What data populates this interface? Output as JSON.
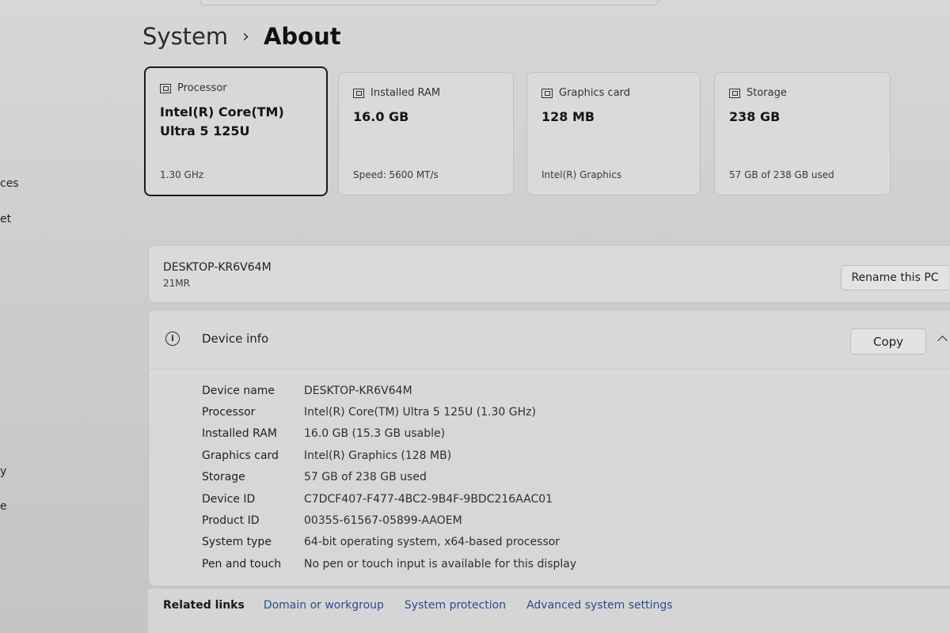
{
  "breadcrumb": {
    "parent": "System",
    "separator": "›",
    "current": "About"
  },
  "left_nav_fragments": [
    "ces",
    "et",
    "y",
    "e"
  ],
  "cards": [
    {
      "label": "Processor",
      "value_line1": "Intel(R) Core(TM)",
      "value_line2": "Ultra 5 125U",
      "sub": "1.30 GHz",
      "icon": "processor-icon"
    },
    {
      "label": "Installed RAM",
      "value_line1": "16.0 GB",
      "value_line2": "",
      "sub": "Speed: 5600 MT/s",
      "icon": "ram-icon"
    },
    {
      "label": "Graphics card",
      "value_line1": "128 MB",
      "value_line2": "",
      "sub": "Intel(R) Graphics",
      "icon": "graphics-card-icon"
    },
    {
      "label": "Storage",
      "value_line1": "238 GB",
      "value_line2": "",
      "sub": "57 GB of 238 GB used",
      "icon": "storage-icon"
    }
  ],
  "pc": {
    "name": "DESKTOP-KR6V64M",
    "model": "21MR",
    "rename_label": "Rename this PC"
  },
  "device_info": {
    "title": "Device info",
    "copy_label": "Copy",
    "rows": [
      {
        "label": "Device name",
        "value": "DESKTOP-KR6V64M"
      },
      {
        "label": "Processor",
        "value": "Intel(R) Core(TM) Ultra 5 125U (1.30 GHz)"
      },
      {
        "label": "Installed RAM",
        "value": "16.0 GB (15.3 GB usable)"
      },
      {
        "label": "Graphics card",
        "value": "Intel(R) Graphics (128 MB)"
      },
      {
        "label": "Storage",
        "value": "57 GB of 238 GB used"
      },
      {
        "label": "Device ID",
        "value": "C7DCF407-F477-4BC2-9B4F-9BDC216AAC01"
      },
      {
        "label": "Product ID",
        "value": "00355-61567-05899-AAOEM"
      },
      {
        "label": "System type",
        "value": "64-bit operating system, x64-based processor"
      },
      {
        "label": "Pen and touch",
        "value": "No pen or touch input is available for this display"
      }
    ]
  },
  "related": {
    "title": "Related links",
    "links": [
      "Domain or workgroup",
      "System protection",
      "Advanced system settings"
    ]
  },
  "colors": {
    "background": "#c7c7c7",
    "panel": "#dadada",
    "link": "#294f8a",
    "text": "#1f1f1f"
  }
}
